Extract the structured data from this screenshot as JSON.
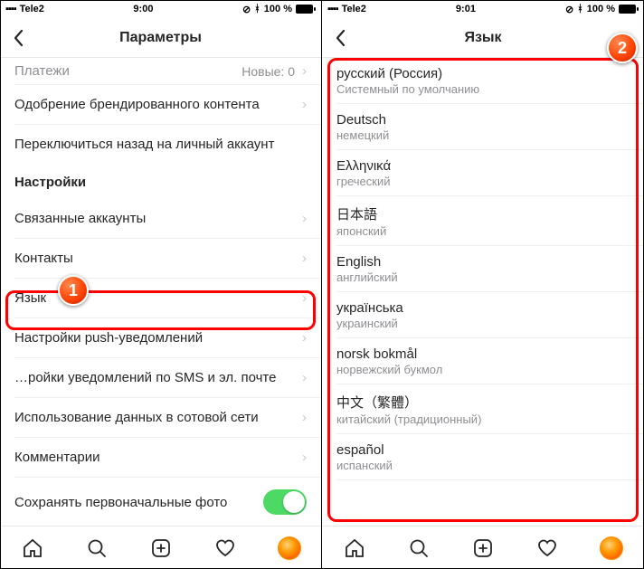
{
  "statusbar": {
    "carrier": "Tele2",
    "time_left": "9:00",
    "time_right": "9:01",
    "battery": "100 %"
  },
  "left": {
    "title": "Параметры",
    "rows": {
      "payments": "Платежи",
      "payments_meta": "Новые: 0",
      "branded": "Одобрение брендированного контента",
      "switch_back": "Переключиться назад на личный аккаунт",
      "section_settings": "Настройки",
      "linked": "Связанные аккаунты",
      "contacts": "Контакты",
      "language": "Язык",
      "push": "Настройки push-уведомлений",
      "sms": "…ройки уведомлений по SMS и эл. почте",
      "cellular": "Использование данных в сотовой сети",
      "comments": "Комментарии",
      "save_original": "Сохранять первоначальные фото"
    }
  },
  "right": {
    "title": "Язык",
    "languages": [
      {
        "primary": "русский (Россия)",
        "secondary": "Системный по умолчанию"
      },
      {
        "primary": "Deutsch",
        "secondary": "немецкий"
      },
      {
        "primary": "Ελληνικά",
        "secondary": "греческий"
      },
      {
        "primary": "日本語",
        "secondary": "японский"
      },
      {
        "primary": "English",
        "secondary": "английский"
      },
      {
        "primary": "українська",
        "secondary": "украинский"
      },
      {
        "primary": "norsk bokmål",
        "secondary": "норвежский букмол"
      },
      {
        "primary": "中文（繁體）",
        "secondary": "китайский (традиционный)"
      },
      {
        "primary": "español",
        "secondary": "испанский"
      }
    ]
  },
  "badges": {
    "one": "1",
    "two": "2"
  }
}
